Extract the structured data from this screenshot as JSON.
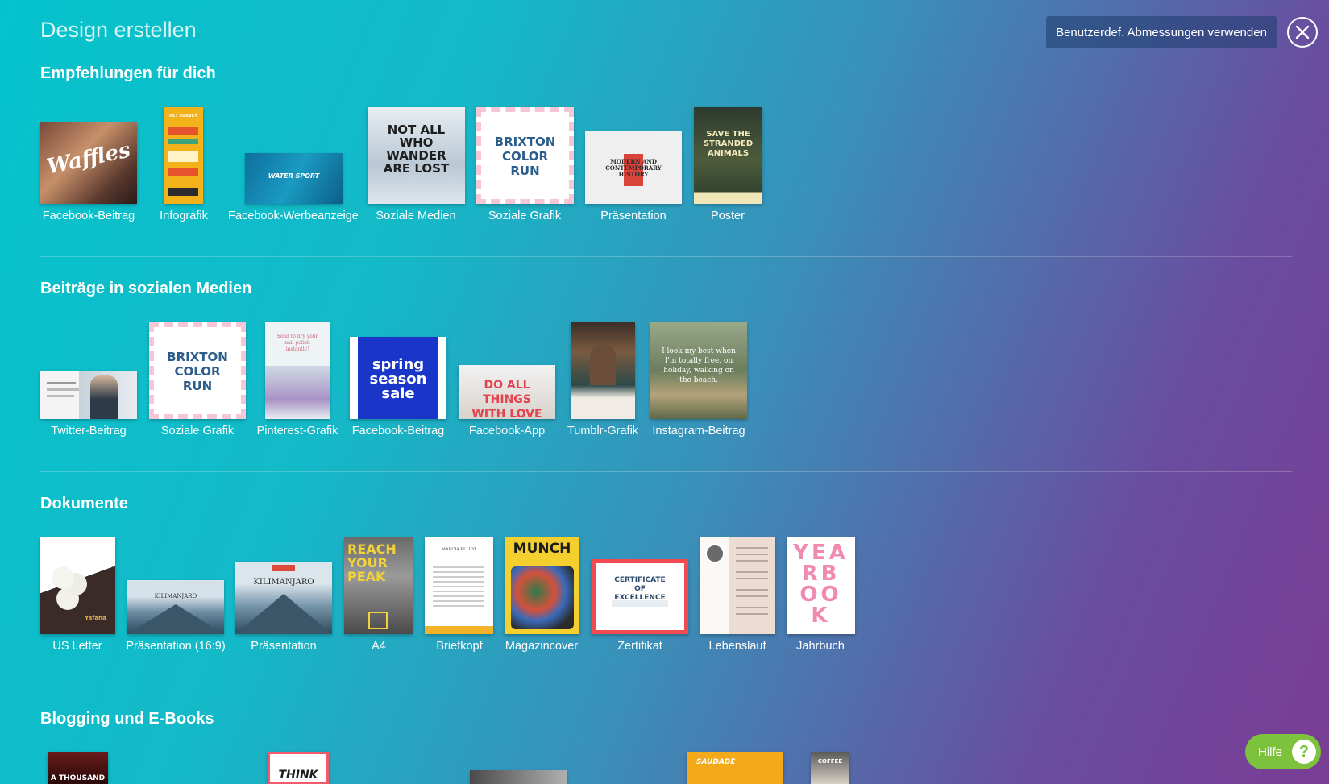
{
  "header": {
    "title": "Design erstellen",
    "custom_dimensions_label": "Benutzerdef. Abmessungen verwenden"
  },
  "sections": [
    {
      "title": "Empfehlungen für dich",
      "items": [
        {
          "label": "Facebook-Beitrag",
          "thumb_text": "Waffles"
        },
        {
          "label": "Infografik",
          "thumb_text": "PET SURVEY"
        },
        {
          "label": "Facebook-Werbeanzeige",
          "thumb_text": "WATER SPORT"
        },
        {
          "label": "Soziale Medien",
          "thumb_text": "NOT ALL WHO WANDER ARE LOST"
        },
        {
          "label": "Soziale Grafik",
          "thumb_text": "BRIXTON COLOR RUN"
        },
        {
          "label": "Präsentation",
          "thumb_text": "MODERN AND CONTEMPORARY HISTORY"
        },
        {
          "label": "Poster",
          "thumb_text": "SAVE THE STRANDED ANIMALS"
        }
      ]
    },
    {
      "title": "Beiträge in sozialen Medien",
      "items": [
        {
          "label": "Twitter-Beitrag",
          "thumb_text": ""
        },
        {
          "label": "Soziale Grafik",
          "thumb_text": "BRIXTON COLOR RUN"
        },
        {
          "label": "Pinterest-Grafik",
          "thumb_text": "Send to dry your nail polish instantly!"
        },
        {
          "label": "Facebook-Beitrag",
          "thumb_text": "spring season sale"
        },
        {
          "label": "Facebook-App",
          "thumb_text": "DO ALL THINGS WITH LOVE"
        },
        {
          "label": "Tumblr-Grafik",
          "thumb_text": ""
        },
        {
          "label": "Instagram-Beitrag",
          "thumb_text": "I look my best when I'm totally free, on holiday, walking on the beach."
        }
      ]
    },
    {
      "title": "Dokumente",
      "items": [
        {
          "label": "US Letter",
          "thumb_text": "Yafana"
        },
        {
          "label": "Präsentation (16:9)",
          "thumb_text": "KILIMANJARO"
        },
        {
          "label": "Präsentation",
          "thumb_text": "KILIMANJARO"
        },
        {
          "label": "A4",
          "thumb_text": "REACH YOUR PEAK"
        },
        {
          "label": "Briefkopf",
          "thumb_text": "MARCIA ELLIOT"
        },
        {
          "label": "Magazincover",
          "thumb_text": "MUNCH"
        },
        {
          "label": "Zertifikat",
          "thumb_text": "CERTIFICATE OF EXCELLENCE"
        },
        {
          "label": "Lebenslauf",
          "thumb_text": ""
        },
        {
          "label": "Jahrbuch",
          "thumb_text": "YEARBOOK"
        }
      ]
    },
    {
      "title": "Blogging und E-Books",
      "items": [
        {
          "label": "",
          "thumb_text": "A THOUSAND"
        },
        {
          "label": "",
          "thumb_text": "THINK"
        },
        {
          "label": "",
          "thumb_text": ""
        },
        {
          "label": "",
          "thumb_text": "SAUDADE"
        },
        {
          "label": "",
          "thumb_text": "COFFEE"
        }
      ]
    }
  ],
  "help": {
    "label": "Hilfe",
    "icon_glyph": "?"
  },
  "colors": {
    "accent_help": "#7cc23d",
    "button_bg": "#2a4f86"
  }
}
